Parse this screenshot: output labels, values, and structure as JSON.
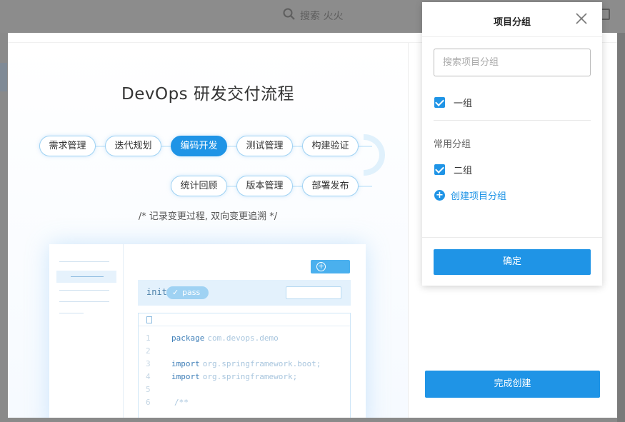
{
  "background": {
    "search_label": "搜索 火火"
  },
  "hero": {
    "title": "DevOps 研发交付流程",
    "flow_steps": [
      {
        "label": "需求管理",
        "active": false
      },
      {
        "label": "迭代规划",
        "active": false
      },
      {
        "label": "编码开发",
        "active": true
      },
      {
        "label": "测试管理",
        "active": false
      },
      {
        "label": "构建验证",
        "active": false
      },
      {
        "label": "统计回顾",
        "active": false
      },
      {
        "label": "版本管理",
        "active": false
      },
      {
        "label": "部署发布",
        "active": false
      }
    ],
    "caption": "/* 记录变更过程, 双向变更追溯 */"
  },
  "illustration": {
    "run_name": "init",
    "run_status": "pass",
    "code_lines": [
      {
        "no": "1",
        "kw": "package",
        "text": "com.devops.demo"
      },
      {
        "no": "2",
        "kw": "",
        "text": ""
      },
      {
        "no": "3",
        "kw": "import",
        "text": "org.springframework.boot;"
      },
      {
        "no": "4",
        "kw": "import",
        "text": "org.springframework;"
      },
      {
        "no": "5",
        "kw": "",
        "text": ""
      },
      {
        "no": "6",
        "kw": "",
        "text": "/**"
      }
    ]
  },
  "popup": {
    "title": "项目分组",
    "search_placeholder": "搜索项目分组",
    "groups": [
      {
        "label": "一组",
        "checked": true
      }
    ],
    "common_section_title": "常用分组",
    "common_groups": [
      {
        "label": "二组",
        "checked": true
      }
    ],
    "create_label": "创建项目分组",
    "confirm_label": "确定"
  },
  "footer": {
    "finish_label": "完成创建"
  },
  "colors": {
    "primary": "#1f94e6",
    "pill_border": "#9fd2f3",
    "overlay": "#8a8a8a"
  }
}
